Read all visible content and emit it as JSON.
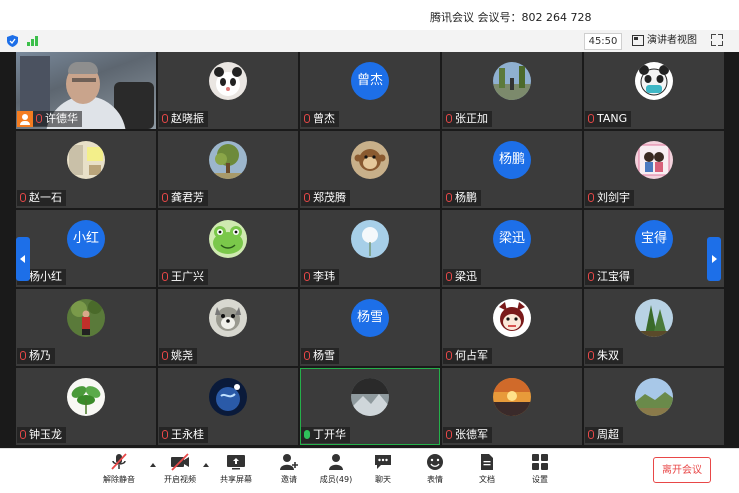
{
  "window": {
    "title": "腾讯会议 会议号：802 264 728"
  },
  "status": {
    "timer": "45:50",
    "speaker_view": "演讲者视图"
  },
  "participants": [
    {
      "name": "许德华",
      "avatar": "video",
      "mic": "off",
      "host": true
    },
    {
      "name": "赵晓振",
      "avatar": "panda",
      "mic": "off"
    },
    {
      "name": "曾杰",
      "avatar": "text",
      "avatar_text": "曾杰",
      "mic": "off"
    },
    {
      "name": "张正加",
      "avatar": "street",
      "mic": "off"
    },
    {
      "name": "TANG",
      "avatar": "panda-mask",
      "mic": "off"
    },
    {
      "name": "赵一石",
      "avatar": "room",
      "mic": "off"
    },
    {
      "name": "龚君芳",
      "avatar": "tree",
      "mic": "off"
    },
    {
      "name": "郑茂腾",
      "avatar": "monkey",
      "mic": "off"
    },
    {
      "name": "杨鹏",
      "avatar": "text",
      "avatar_text": "杨鹏",
      "mic": "off"
    },
    {
      "name": "刘剑宇",
      "avatar": "couple",
      "mic": "off"
    },
    {
      "name": "杨小红",
      "avatar": "text",
      "avatar_text": "小红",
      "mic": "off"
    },
    {
      "name": "王广兴",
      "avatar": "frog",
      "mic": "off"
    },
    {
      "name": "李玮",
      "avatar": "dandelion",
      "mic": "off"
    },
    {
      "name": "梁迅",
      "avatar": "text",
      "avatar_text": "梁迅",
      "mic": "off"
    },
    {
      "name": "江宝得",
      "avatar": "text",
      "avatar_text": "宝得",
      "mic": "off"
    },
    {
      "name": "杨乃",
      "avatar": "person",
      "mic": "off"
    },
    {
      "name": "姚尧",
      "avatar": "dog",
      "mic": "off"
    },
    {
      "name": "杨雪",
      "avatar": "text",
      "avatar_text": "杨雪",
      "mic": "off"
    },
    {
      "name": "何占军",
      "avatar": "cartoon",
      "mic": "off"
    },
    {
      "name": "朱双",
      "avatar": "forest",
      "mic": "off"
    },
    {
      "name": "钟玉龙",
      "avatar": "plant",
      "mic": "off"
    },
    {
      "name": "王永桂",
      "avatar": "earth",
      "mic": "off"
    },
    {
      "name": "丁开华",
      "avatar": "mountain",
      "mic": "on",
      "active": true
    },
    {
      "name": "张德军",
      "avatar": "sunset",
      "mic": "off"
    },
    {
      "name": "周超",
      "avatar": "landscape",
      "mic": "off"
    }
  ],
  "toolbar": {
    "unmute": "解除静音",
    "video": "开启视频",
    "share": "共享屏幕",
    "invite": "邀请",
    "members": "成员(49)",
    "chat": "聊天",
    "emoji": "表情",
    "docs": "文档",
    "settings": "设置",
    "leave": "离开会议"
  },
  "colors": {
    "accent": "#1d6fe8",
    "danger": "#e84848",
    "host": "#f47c20",
    "active": "#25b04a"
  }
}
